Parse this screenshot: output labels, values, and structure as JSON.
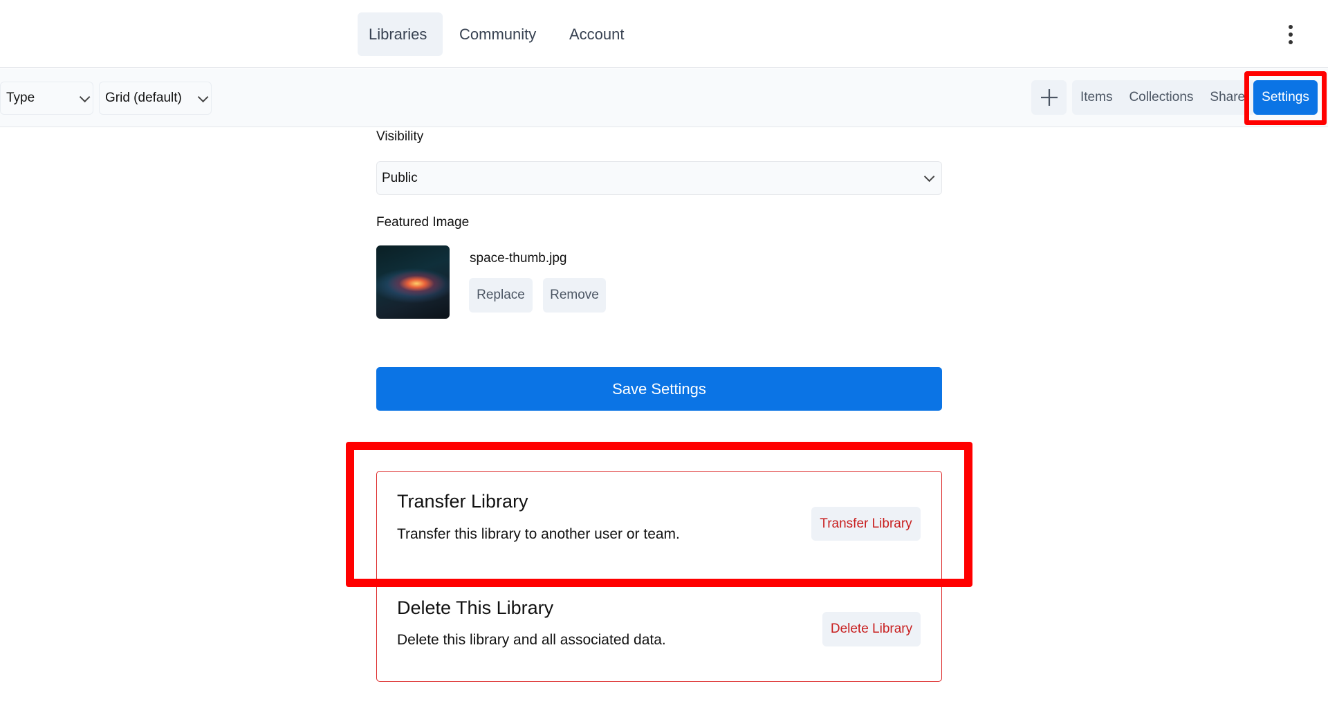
{
  "nav": {
    "tabs": [
      {
        "label": "Libraries",
        "active": true
      },
      {
        "label": "Community",
        "active": false
      },
      {
        "label": "Account",
        "active": false
      }
    ],
    "more_icon": "kebab-vertical-icon"
  },
  "toolbar": {
    "type_filter": "Type",
    "view_mode": "Grid (default)",
    "add_icon": "plus-icon",
    "segments": [
      "Items",
      "Collections",
      "Share"
    ],
    "settings_label": "Settings"
  },
  "settings": {
    "visibility_label": "Visibility",
    "visibility_value": "Public",
    "featured_label": "Featured Image",
    "featured_filename": "space-thumb.jpg",
    "replace_label": "Replace",
    "remove_label": "Remove",
    "save_label": "Save Settings"
  },
  "danger_zone": {
    "transfer": {
      "title": "Transfer Library",
      "description": "Transfer this library to another user or team.",
      "button": "Transfer Library"
    },
    "delete": {
      "title": "Delete This Library",
      "description": "Delete this library and all associated data.",
      "button": "Delete Library"
    }
  },
  "colors": {
    "accent": "#0b74e5",
    "danger": "#dc2626",
    "highlight": "#ff0000"
  }
}
